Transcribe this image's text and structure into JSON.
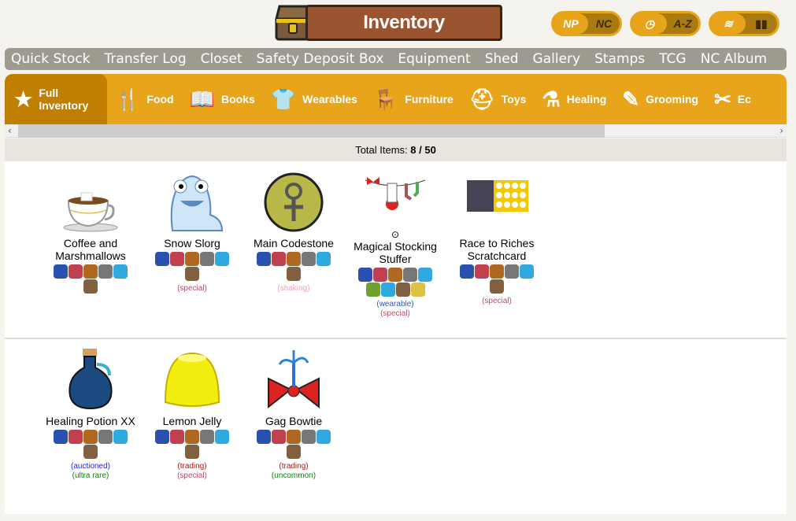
{
  "header": {
    "title": "Inventory",
    "currency_toggle": {
      "on": "NP",
      "off": "NC"
    },
    "sort_toggle": {
      "on": "clock-icon",
      "off": "A-Z"
    },
    "view_toggle": {
      "on": "stack-icon",
      "off": "columns-icon"
    }
  },
  "nav": [
    "Quick Stock",
    "Transfer Log",
    "Closet",
    "Safety Deposit Box",
    "Equipment",
    "Shed",
    "Gallery",
    "Stamps",
    "TCG",
    "NC Album"
  ],
  "categories": [
    {
      "label": "Full Inventory",
      "icon": "★"
    },
    {
      "label": "Food",
      "icon": "🍴"
    },
    {
      "label": "Books",
      "icon": "📖"
    },
    {
      "label": "Wearables",
      "icon": "👕"
    },
    {
      "label": "Furniture",
      "icon": "🪑"
    },
    {
      "label": "Toys",
      "icon": "⛑"
    },
    {
      "label": "Healing",
      "icon": "⚗"
    },
    {
      "label": "Grooming",
      "icon": "✎"
    },
    {
      "label": "Ec",
      "icon": "✂"
    }
  ],
  "total": {
    "label": "Total Items:",
    "value": "8 / 50"
  },
  "colors": {
    "accent": "#e8a51c",
    "accent_dark": "#c17f00",
    "nav": "#9f9a8f",
    "special": "#b05070",
    "shaking": "#f4a0b8",
    "wearable": "#3355bb",
    "trading": "#a01818",
    "auctioned": "#2222ff",
    "rare": "#108010"
  },
  "items": [
    {
      "name": "Coffee and Marshmallows",
      "image": "coffee",
      "extra": [],
      "tags": []
    },
    {
      "name": "Snow Slorg",
      "image": "slorg",
      "extra": [],
      "tags": [
        {
          "t": "(special)",
          "c": "#b05070"
        }
      ]
    },
    {
      "name": "Main Codestone",
      "image": "codestone",
      "extra": [],
      "tags": [
        {
          "t": "(shaking)",
          "c": "#f4a0b8"
        }
      ]
    },
    {
      "name": "Magical Stocking Stuffer",
      "image": "stocking",
      "badge": "hanger-icon",
      "extra": [
        "tree",
        "magnifier"
      ],
      "tags": [
        {
          "t": "(wearable)",
          "c": "#3355bb"
        },
        {
          "t": "(special)",
          "c": "#b05070"
        }
      ]
    },
    {
      "name": "Race to Riches Scratchcard",
      "image": "scratch",
      "extra": [],
      "tags": [
        {
          "t": "(special)",
          "c": "#b05070"
        }
      ]
    },
    {
      "name": "Healing Potion XX",
      "image": "potion",
      "extra": [],
      "tags": [
        {
          "t": "(auctioned)",
          "c": "#2222ff"
        },
        {
          "t": "(ultra rare)",
          "c": "#108010"
        }
      ]
    },
    {
      "name": "Lemon Jelly",
      "image": "jelly",
      "extra": [],
      "tags": [
        {
          "t": "(trading)",
          "c": "#a01818"
        },
        {
          "t": "(special)",
          "c": "#b05070"
        }
      ]
    },
    {
      "name": "Gag Bowtie",
      "image": "bowtie",
      "extra": [],
      "tags": [
        {
          "t": "(trading)",
          "c": "#a01818"
        },
        {
          "t": "(uncommon)",
          "c": "#108010"
        }
      ]
    }
  ],
  "actions": [
    "wizard-hat",
    "rose",
    "kiosk",
    "safe",
    "blob",
    "trolley"
  ]
}
